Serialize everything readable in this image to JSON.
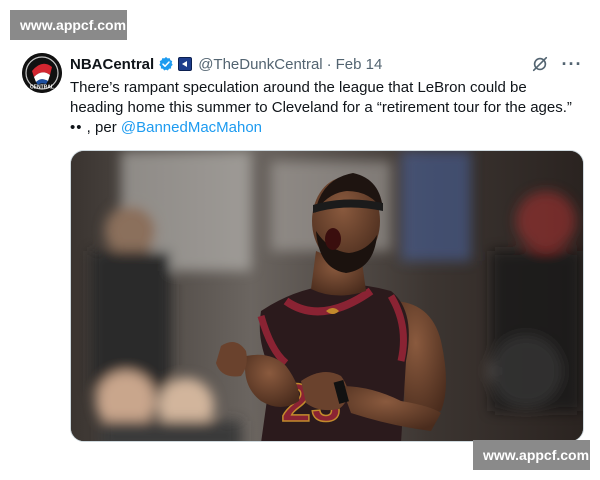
{
  "watermark": {
    "text": "www.appcf.com"
  },
  "tweet": {
    "display_name": "NBACentral",
    "handle": "@TheDunkCentral",
    "separator": "·",
    "date": "Feb 14",
    "text_line1": "There’s rampant speculation around the league that LeBron could be",
    "text_line2": "heading home this summer to Cleveland for a “retirement tour for the ages.”",
    "text_prefix_emoji": "••",
    "text_per": " , per ",
    "mention": "@BannedMacMahon",
    "more_label": "···",
    "avatar_label": "CENTRAL",
    "jersey_number": "23",
    "colors": {
      "accent": "#1d9bf0",
      "verified": "#1d9bf0",
      "jersey": "#2b1a1c",
      "jersey_trim": "#8a2333",
      "jersey_gold": "#c28a2c"
    },
    "icons": [
      "verified-icon",
      "affiliate-badge-icon",
      "grok-icon",
      "more-icon"
    ]
  }
}
